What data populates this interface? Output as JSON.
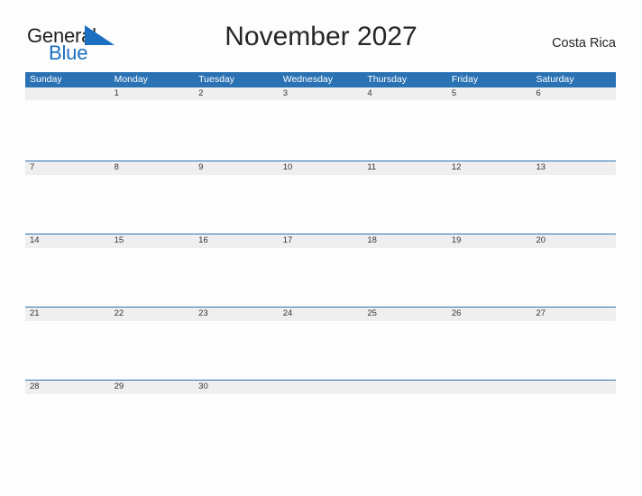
{
  "brand": {
    "name_part1": "General",
    "name_part2": "Blue",
    "flag_icon": "blue-triangle-flag-icon",
    "color_dark": "#231f20",
    "color_blue": "#1b6fc1"
  },
  "header": {
    "title": "November 2027",
    "locale": "Costa Rica"
  },
  "theme": {
    "header_band": "#2b72b4",
    "date_strip": "#efefef",
    "rule": "#2b72b4",
    "page_background": "#fdfdfd",
    "text": "#333333"
  },
  "calendar": {
    "month": "November",
    "year": "2027",
    "weekdays": [
      "Sunday",
      "Monday",
      "Tuesday",
      "Wednesday",
      "Thursday",
      "Friday",
      "Saturday"
    ],
    "weeks": [
      {
        "days": [
          "",
          "1",
          "2",
          "3",
          "4",
          "5",
          "6"
        ]
      },
      {
        "days": [
          "7",
          "8",
          "9",
          "10",
          "11",
          "12",
          "13"
        ]
      },
      {
        "days": [
          "14",
          "15",
          "16",
          "17",
          "18",
          "19",
          "20"
        ]
      },
      {
        "days": [
          "21",
          "22",
          "23",
          "24",
          "25",
          "26",
          "27"
        ]
      },
      {
        "days": [
          "28",
          "29",
          "30",
          "",
          "",
          "",
          ""
        ]
      }
    ]
  }
}
